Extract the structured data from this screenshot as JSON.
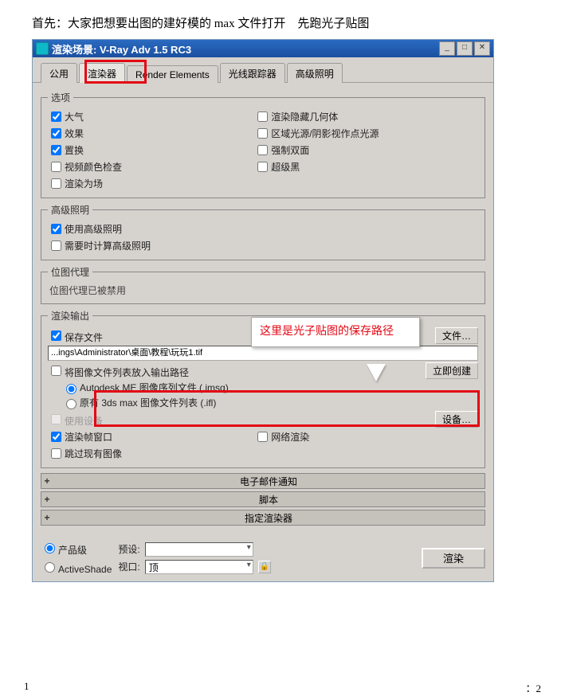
{
  "intro": "首先：大家把想要出图的建好模的 max 文件打开　先跑光子贴图",
  "window": {
    "title": "渲染场景: V-Ray Adv 1.5 RC3"
  },
  "tabs": {
    "common": "公用",
    "renderer": "渲染器",
    "elements": "Render Elements",
    "raytracer": "光线跟踪器",
    "advlight": "高级照明"
  },
  "opt": {
    "legend": "选项",
    "atm": "大气",
    "hidden": "渲染隐藏几何体",
    "eff": "效果",
    "area": "区域光源/阴影视作点光源",
    "disp": "置换",
    "force2": "强制双面",
    "vidchk": "视频颜色检查",
    "superblk": "超级黑",
    "renfield": "渲染为场"
  },
  "adv": {
    "legend": "高级照明",
    "use": "使用高级照明",
    "calc": "需要时计算高级照明"
  },
  "bmp": {
    "legend": "位图代理",
    "txt": "位图代理已被禁用"
  },
  "out": {
    "legend": "渲染输出",
    "save": "保存文件",
    "path_btn": "文件…",
    "path_val": "...ings\\Administrator\\桌面\\教程\\玩玩1.tif",
    "putlist": "将图像文件列表放入输出路径",
    "now_btn": "立即创建",
    "ame": "Autodesk ME 图像序列文件 (.imsq)",
    "ifl": "原有 3ds max 图像文件列表 (.ifl)",
    "usedev": "使用设备",
    "dev_btn": "设备…",
    "rendwin": "渲染帧窗口",
    "netren": "网络渲染",
    "skip": "跳过现有图像"
  },
  "rolls": {
    "email": "电子邮件通知",
    "script": "脚本",
    "assign": "指定渲染器"
  },
  "foot": {
    "prod": "产品级",
    "as": "ActiveShade",
    "preset": "预设:",
    "preset_val": "",
    "viewport": "视口:",
    "vp_val": "顶",
    "render": "渲染"
  },
  "callout": "这里是光子贴图的保存路径",
  "pg": {
    "l": "1",
    "r": "：2"
  }
}
